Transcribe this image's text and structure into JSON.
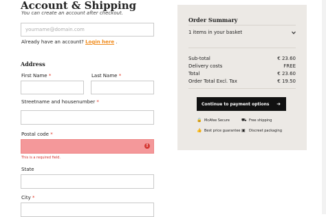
{
  "account": {
    "title": "Account & Shipping",
    "subtitle": "You can create an account after checkout.",
    "email_placeholder": "yourname@domain.com",
    "have_account_text": "Already have an account?",
    "login_link": "Login here",
    "login_trailing": "."
  },
  "address": {
    "heading": "Address",
    "first_name_label": "First Name",
    "last_name_label": "Last Name",
    "street_label": "Streetname and housenumber",
    "postal_label": "Postal code",
    "postal_error": "This is a required field.",
    "state_label": "State",
    "city_label": "City",
    "required_mark": "*"
  },
  "summary": {
    "heading": "Order Summary",
    "basket_text": "1 items in your basket",
    "rows": [
      {
        "label": "Sub-total",
        "value": "€ 23.60"
      },
      {
        "label": "Delivery costs",
        "value": "FREE"
      },
      {
        "label": "Total",
        "value": "€ 23.60"
      },
      {
        "label": "Order Total Excl. Tax",
        "value": "€ 19.50"
      }
    ],
    "pay_button": "Continue to payment options",
    "features": [
      {
        "icon": "lock-icon",
        "label": "McAfee Secure"
      },
      {
        "icon": "truck-icon",
        "label": "Free shipping"
      },
      {
        "icon": "thumbs-up-icon",
        "label": "Best price guarantee"
      },
      {
        "icon": "package-icon",
        "label": "Discreet packaging"
      }
    ]
  },
  "colors": {
    "error_fill": "#f4989a",
    "error_text": "#d22f2b",
    "link": "#f08c1e",
    "panel_bg": "#ece9e5",
    "button_bg": "#111111"
  }
}
